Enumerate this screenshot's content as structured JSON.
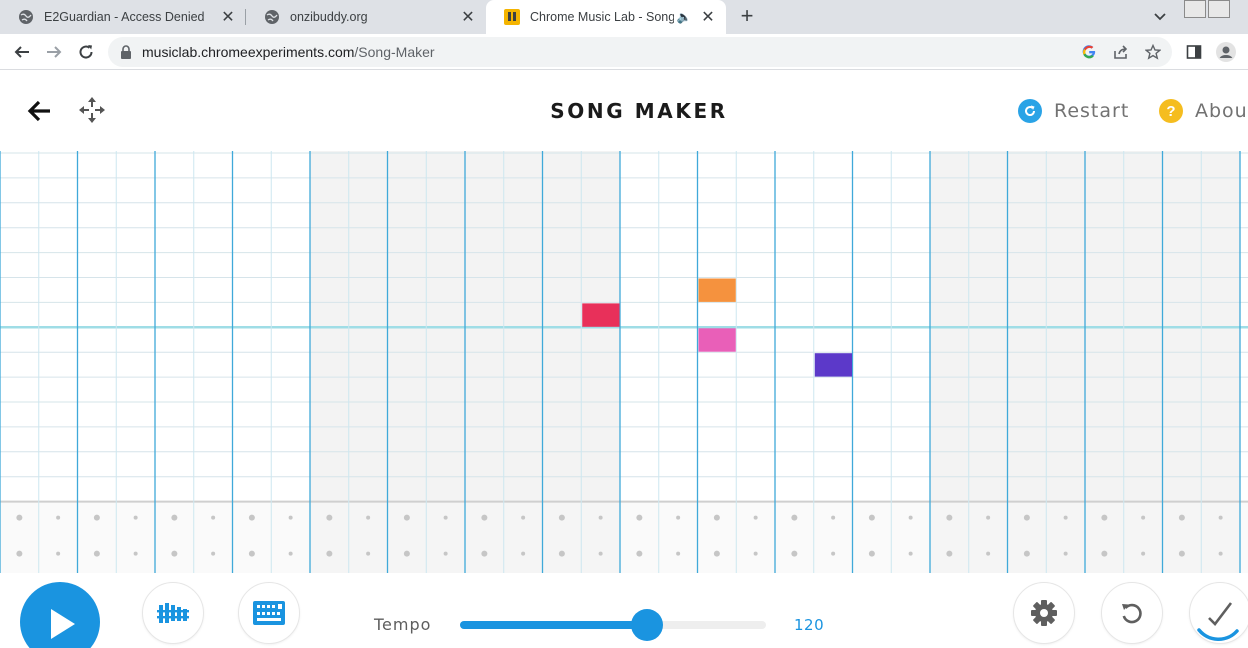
{
  "browser": {
    "tabs": [
      {
        "title": "E2Guardian - Access Denied",
        "active": false
      },
      {
        "title": "onzibuddy.org",
        "active": false
      },
      {
        "title": "Chrome Music Lab - Song M",
        "active": true,
        "audible": true
      }
    ],
    "url": {
      "domain": "musiclab.chromeexperiments.com",
      "path": "/Song-Maker"
    }
  },
  "app": {
    "title": "SONG MAKER",
    "restart_label": "Restart",
    "about_label": "About"
  },
  "song_grid": {
    "columns": 32,
    "melody_rows": 14,
    "percussion_rows": 2,
    "notes": [
      {
        "column": 15,
        "row": 6,
        "color": "#e8305a"
      },
      {
        "column": 18,
        "row": 5,
        "color": "#f5923e"
      },
      {
        "column": 18,
        "row": 7,
        "color": "#e95fb8"
      },
      {
        "column": 21,
        "row": 8,
        "color": "#5c39c9"
      }
    ]
  },
  "controls": {
    "tempo_label": "Tempo",
    "tempo_value": "120",
    "tempo_fraction": 0.61
  },
  "colors": {
    "accent": "#1a94e0",
    "grid_line": "#b4dcea",
    "bar_line": "#3fa9d9",
    "octave_line": "#9fdde6",
    "shaded_section": "#f3f3f3",
    "restart_icon": "#2aa3e6",
    "about_icon": "#f5bd1f"
  }
}
